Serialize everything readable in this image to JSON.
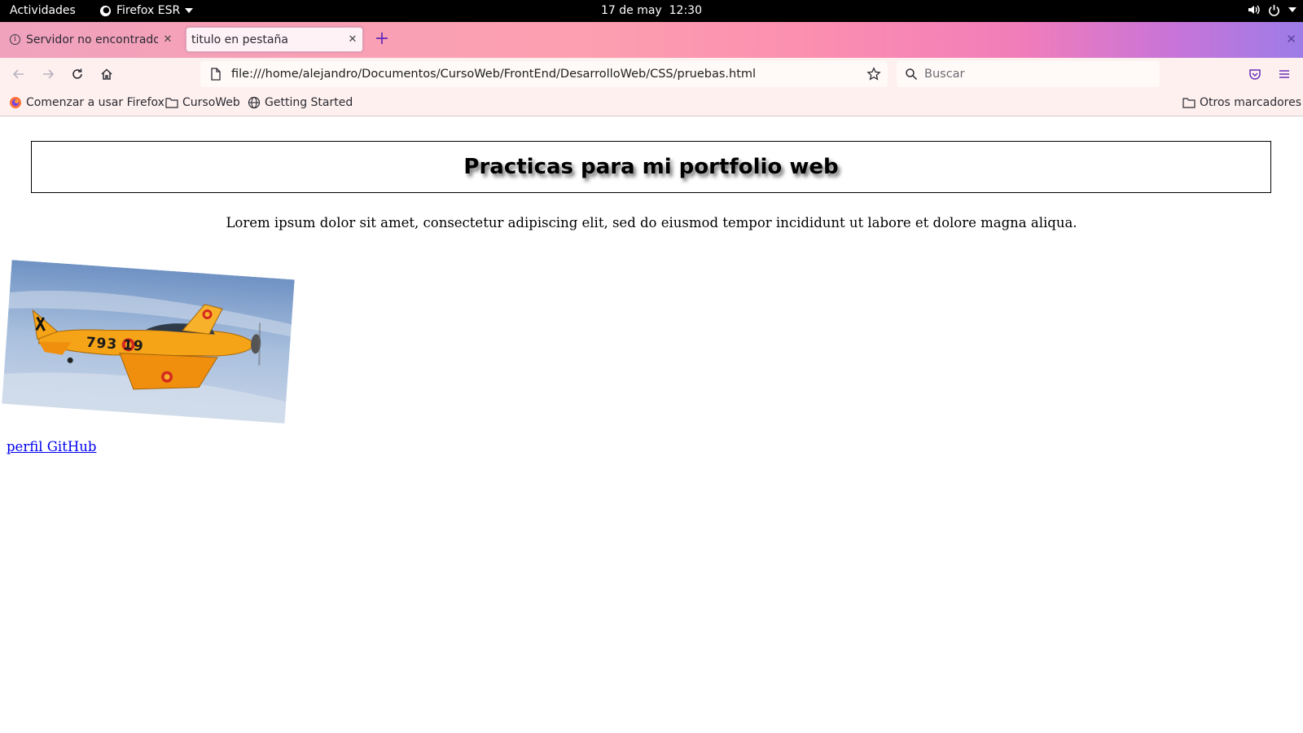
{
  "system_bar": {
    "activities": "Actividades",
    "app_name": "Firefox ESR",
    "date": "17 de may",
    "time": "12:30"
  },
  "tabs": [
    {
      "label": "Servidor no encontrado",
      "icon": "info-icon",
      "active": false
    },
    {
      "label": "titulo en pestaña",
      "icon": "",
      "active": true
    }
  ],
  "navigation": {
    "url": "file:///home/alejandro/Documentos/CursoWeb/FrontEnd/DesarrolloWeb/CSS/pruebas.html",
    "search_placeholder": "Buscar"
  },
  "bookmarks": {
    "items": [
      {
        "label": "Comenzar a usar Firefox",
        "icon": "firefox-icon"
      },
      {
        "label": "CursoWeb",
        "icon": "folder-icon"
      },
      {
        "label": "Getting Started",
        "icon": "globe-icon"
      }
    ],
    "other_label": "Otros marcadores"
  },
  "page": {
    "heading": "Practicas para mi portfolio web",
    "paragraph": "Lorem ipsum dolor sit amet, consectetur adipiscing elit, sed do eiusmod tempor incididunt ut labore et dolore magna aliqua.",
    "plane_numbers": "793 19",
    "link_label": "perfil GitHub"
  },
  "colors": {
    "accent": "#6a2fb8",
    "link": "#0000ee",
    "plane_body": "#f5a418"
  }
}
